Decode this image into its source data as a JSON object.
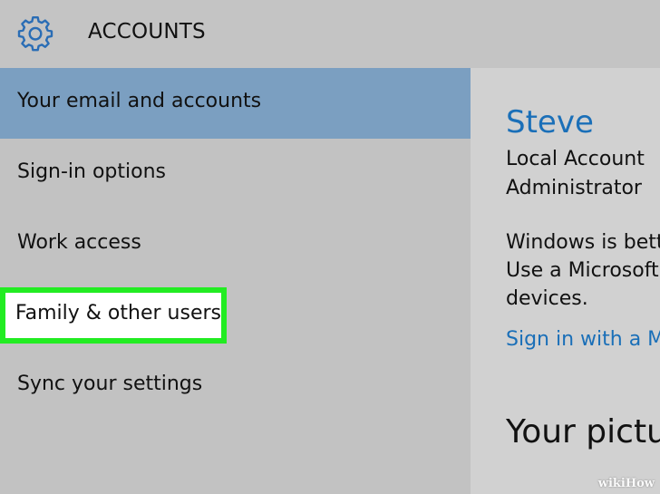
{
  "header": {
    "icon": "gear-icon",
    "title": "ACCOUNTS"
  },
  "sidebar": {
    "items": [
      {
        "label": "Your email and accounts",
        "state": "selected"
      },
      {
        "label": "Sign-in options"
      },
      {
        "label": "Work access"
      },
      {
        "label": "Family & other users",
        "state": "highlighted"
      },
      {
        "label": "Sync your settings"
      }
    ]
  },
  "main": {
    "user_name": "Steve",
    "account_type": "Local Account",
    "role": "Administrator",
    "info_lines": [
      "Windows is bett",
      "Use a Microsoft",
      "devices."
    ],
    "ms_link": "Sign in with a M",
    "picture_heading": "Your pictu"
  },
  "watermark": "wikiHow",
  "colors": {
    "selected_item_bg": "#7b9fc1",
    "link_blue": "#1a6fb8",
    "highlight_border": "#22ec22"
  }
}
